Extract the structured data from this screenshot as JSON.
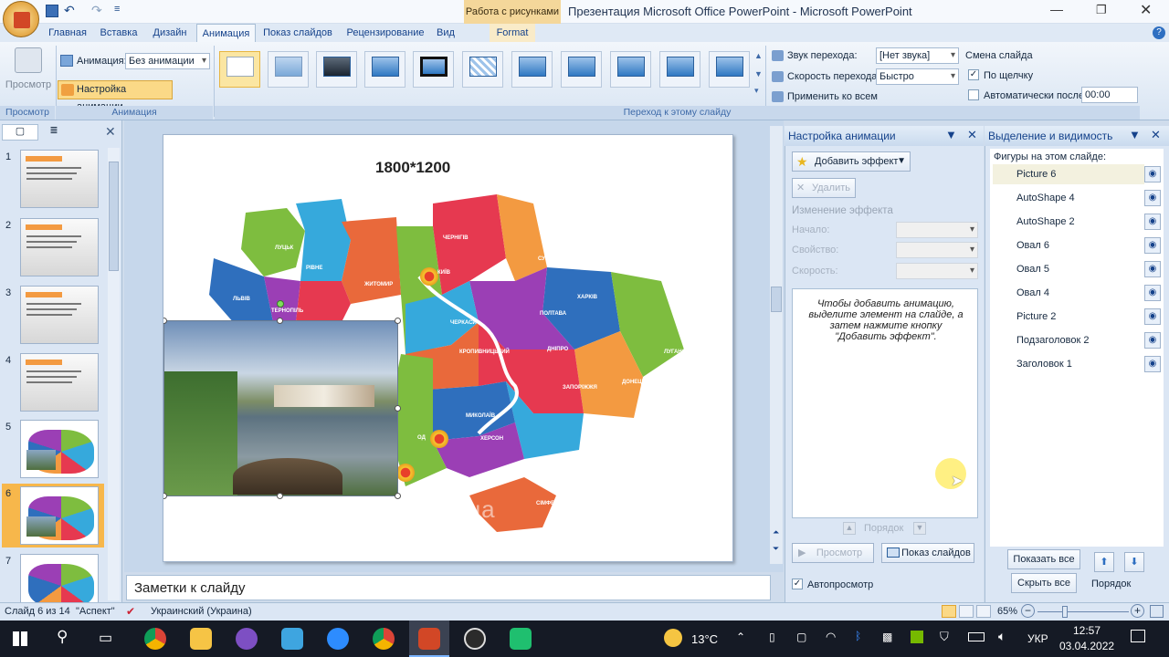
{
  "window": {
    "title": "Презентация Microsoft Office PowerPoint - Microsoft PowerPoint",
    "context_tab": "Работа с рисунками",
    "context_sub": "Format"
  },
  "ribbon_tabs": [
    "Главная",
    "Вставка",
    "Дизайн",
    "Анимация",
    "Показ слайдов",
    "Рецензирование",
    "Вид"
  ],
  "active_tab": "Анимация",
  "ribbon": {
    "preview_label": "Просмотр",
    "preview_group": "Просмотр",
    "animation_label": "Анимация:",
    "animation_value": "Без анимации",
    "custom_anim": "Настройка анимации",
    "animation_group": "Анимация",
    "sound_label": "Звук перехода:",
    "sound_value": "[Нет звука]",
    "speed_label": "Скорость перехода:",
    "speed_value": "Быстро",
    "apply_all": "Применить ко всем",
    "advance_title": "Смена слайда",
    "on_click": "По щелчку",
    "auto_after": "Автоматически после:",
    "auto_time": "00:00",
    "transition_group": "Переход к этому слайду"
  },
  "slides_panel": {
    "numbers": [
      "1",
      "2",
      "3",
      "4",
      "5",
      "6",
      "7"
    ],
    "current": "6"
  },
  "slide": {
    "title": "1800*1200",
    "watermark": "kurazh.in.ua",
    "regions": [
      "ЛУЦЬК",
      "РІВНЕ",
      "ЖИТОМИР",
      "ЧЕРНІГІВ",
      "СУМИ",
      "ХАРКІВ",
      "ЛУГАНСЬК",
      "ДОНЕЦЬК",
      "ЛЬВІВ",
      "ТЕРНОПІЛЬ",
      "ПОЛТАВА",
      "ЧЕРКАСИ",
      "КРОПИВНИЦЬКИЙ",
      "ДНІПРО",
      "ЗАПОРІЖЖЯ",
      "МИКОЛАЇВ",
      "ХЕРСОН",
      "СІМФЕРОПОЛЬ",
      "КИЇВ",
      "ОД"
    ]
  },
  "notes": "Заметки к слайду",
  "anim_panel": {
    "title": "Настройка анимации",
    "add_effect": "Добавить эффект",
    "delete": "Удалить",
    "change_effect": "Изменение эффекта",
    "start": "Начало:",
    "property": "Свойство:",
    "speed": "Скорость:",
    "hint": "Чтобы добавить анимацию, выделите элемент на слайде, а затем нажмите кнопку \"Добавить эффект\".",
    "order": "Порядок",
    "preview": "Просмотр",
    "slideshow": "Показ слайдов",
    "autopreview": "Автопросмотр"
  },
  "sel_panel": {
    "title": "Выделение и видимость",
    "shapes_label": "Фигуры на этом слайде:",
    "items": [
      "Picture 6",
      "AutoShape 4",
      "AutoShape 2",
      "Овал 6",
      "Овал 5",
      "Овал 4",
      "Picture 2",
      "Подзаголовок 2",
      "Заголовок 1"
    ],
    "show_all": "Показать все",
    "hide_all": "Скрыть все",
    "order": "Порядок"
  },
  "status": {
    "slide": "Слайд 6 из 14",
    "theme": "\"Аспект\"",
    "lang": "Украинский (Украина)",
    "zoom": "65%"
  },
  "taskbar": {
    "weather": "13°C",
    "lang": "УКР",
    "time": "12:57",
    "date": "03.04.2022"
  }
}
